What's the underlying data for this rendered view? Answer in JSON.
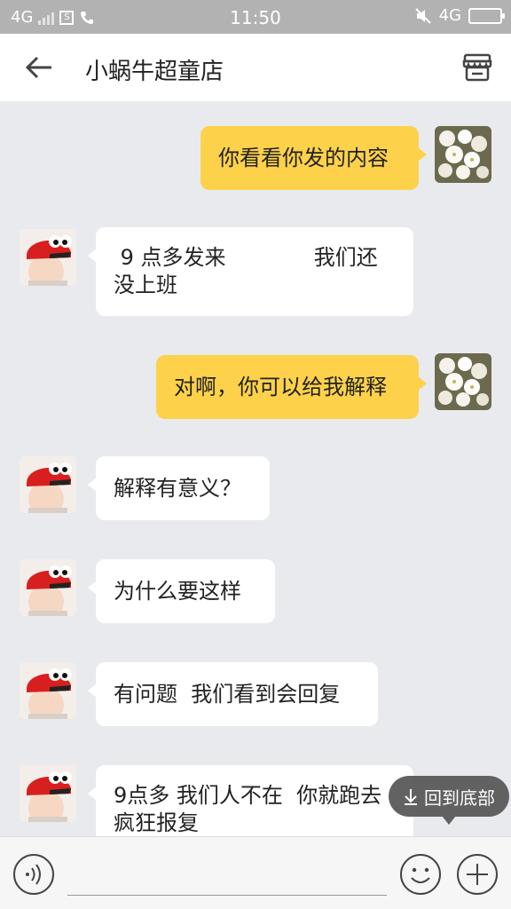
{
  "status_bar": {
    "network_left": "4G",
    "time": "11:50",
    "network_right": "4G"
  },
  "header": {
    "title": "小蜗牛超童店",
    "back_icon": "arrow-left-icon",
    "store_icon": "store-icon"
  },
  "messages": [
    {
      "side": "right",
      "avatar": "flower-avatar",
      "text": "你看看你发的内容"
    },
    {
      "side": "left",
      "avatar": "kid-avatar",
      "text": " 9 点多发来             我们还\n没上班"
    },
    {
      "side": "right",
      "avatar": "flower-avatar",
      "text": "对啊，你可以给我解释"
    },
    {
      "side": "left",
      "avatar": "kid-avatar",
      "text": "解释有意义？"
    },
    {
      "side": "left",
      "avatar": "kid-avatar",
      "text": "为什么要这样"
    },
    {
      "side": "left",
      "avatar": "kid-avatar",
      "text": "有问题  我们看到会回复"
    },
    {
      "side": "left",
      "avatar": "kid-avatar",
      "text": "9点多 我们人不在  你就跑去\n疯狂报复"
    }
  ],
  "back_to_bottom": {
    "label": "回到底部",
    "icon": "arrow-down-icon"
  },
  "input_bar": {
    "placeholder": "",
    "voice_icon": "voice-icon",
    "emoji_icon": "emoji-icon",
    "plus_icon": "plus-icon"
  },
  "colors": {
    "self_bubble": "#fdd24a",
    "other_bubble": "#ffffff",
    "background": "#e9eaee",
    "status_bar": "#b2b2b2"
  }
}
